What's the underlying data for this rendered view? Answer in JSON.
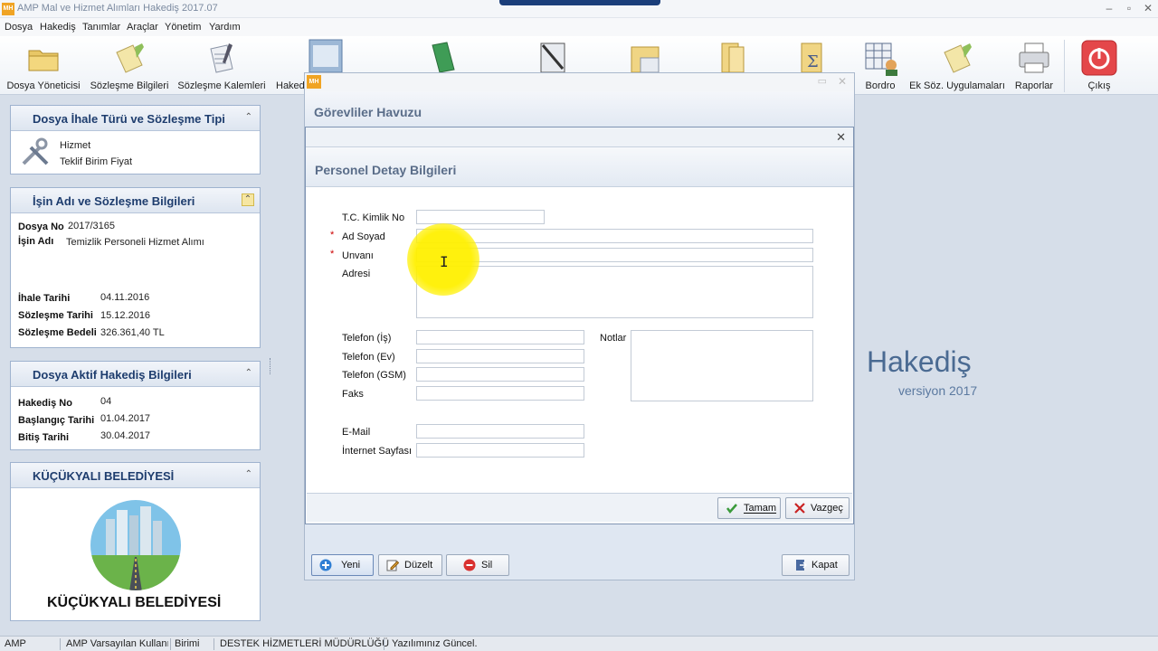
{
  "window": {
    "app_icon_text": "MH",
    "title": "AMP Mal ve Hizmet Alımları Hakediş  2017.07"
  },
  "menu": [
    "Dosya",
    "Hakediş",
    "Tanımlar",
    "Araçlar",
    "Yönetim",
    "Yardım"
  ],
  "toolbar": [
    {
      "label": "Dosya Yöneticisi",
      "icon": "folder-icon"
    },
    {
      "label": "Sözleşme Bilgileri",
      "icon": "contract-document-icon"
    },
    {
      "label": "Sözleşme Kalemleri",
      "icon": "contract-items-icon"
    },
    {
      "label": "Hakediş",
      "icon": "archive-drawer-icon"
    },
    {
      "label": "",
      "icon": "green-book-icon"
    },
    {
      "label": "",
      "icon": "clipboard-icon"
    },
    {
      "label": "",
      "icon": "calculator-folder-icon"
    },
    {
      "label": "",
      "icon": "folders-icon"
    },
    {
      "label": "",
      "icon": "sigma-sum-icon"
    },
    {
      "label": "Bordro",
      "icon": "payroll-table-icon"
    },
    {
      "label": "Ek Söz. Uygulamaları",
      "icon": "additional-contract-icon"
    },
    {
      "label": "Raporlar",
      "icon": "printer-icon"
    },
    {
      "label": "Çıkış",
      "icon": "power-exit-icon"
    }
  ],
  "panels": {
    "ihale_turu": {
      "title": "Dosya İhale Türü ve Sözleşme Tipi",
      "line1": "Hizmet",
      "line2": "Teklif Birim Fiyat"
    },
    "is_adi": {
      "title": "İşin Adı ve Sözleşme Bilgileri",
      "dosya_no_label": "Dosya No",
      "dosya_no": "2017/3165",
      "isin_adi_label": "İşin Adı",
      "isin_adi": "Temizlik Personeli Hizmet Alımı",
      "ihale_tarihi_label": "İhale Tarihi",
      "ihale_tarihi": "04.11.2016",
      "sozlesme_tarihi_label": "Sözleşme Tarihi",
      "sozlesme_tarihi": "15.12.2016",
      "sozlesme_bedeli_label": "Sözleşme Bedeli",
      "sozlesme_bedeli": "326.361,40 TL"
    },
    "aktif_hakedis": {
      "title": "Dosya Aktif Hakediş Bilgileri",
      "hakedis_no_label": "Hakediş No",
      "hakedis_no": "04",
      "baslangic_label": "Başlangıç Tarihi",
      "baslangic": "01.04.2017",
      "bitis_label": "Bitiş Tarihi",
      "bitis": "30.04.2017"
    },
    "belediye": {
      "title": "KÜÇÜKYALI BELEDİYESİ",
      "logo_text": "KÜÇÜKYALI BELEDİYESİ"
    }
  },
  "gorevliler_dialog": {
    "header": "Görevliler Havuzu",
    "buttons": {
      "yeni": "Yeni",
      "duzelt": "Düzelt",
      "sil": "Sil",
      "kapat": "Kapat"
    }
  },
  "personel_dialog": {
    "header": "Personel Detay Bilgileri",
    "fields": {
      "tc": {
        "label": "T.C. Kimlik No",
        "value": ""
      },
      "ad_soyad": {
        "label": "Ad Soyad",
        "value": ""
      },
      "unvani": {
        "label": "Unvanı",
        "value": ""
      },
      "adresi": {
        "label": "Adresi",
        "value": ""
      },
      "tel_is": {
        "label": "Telefon (İş)",
        "value": ""
      },
      "tel_ev": {
        "label": "Telefon (Ev)",
        "value": ""
      },
      "tel_gsm": {
        "label": "Telefon (GSM)",
        "value": ""
      },
      "faks": {
        "label": "Faks",
        "value": ""
      },
      "notlar": {
        "label": "Notlar",
        "value": ""
      },
      "email": {
        "label": "E-Mail",
        "value": ""
      },
      "internet": {
        "label": "İnternet Sayfası",
        "value": ""
      }
    },
    "required_mark": "*",
    "buttons": {
      "tamam": "Tamam",
      "vazgec": "Vazgeç"
    }
  },
  "brand": {
    "name": "Hakediş",
    "version": "versiyon 2017"
  },
  "statusbar": [
    "AMP",
    "AMP Varsayılan Kullanıcı",
    "Birimi",
    "DESTEK HİZMETLERİ MÜDÜRLÜĞÜ",
    "Yazılımınız Güncel."
  ],
  "colors": {
    "panel_title": "#1e3d6e",
    "brand": "#4a6a92",
    "highlight": "#fff000",
    "required": "#cc0000"
  }
}
